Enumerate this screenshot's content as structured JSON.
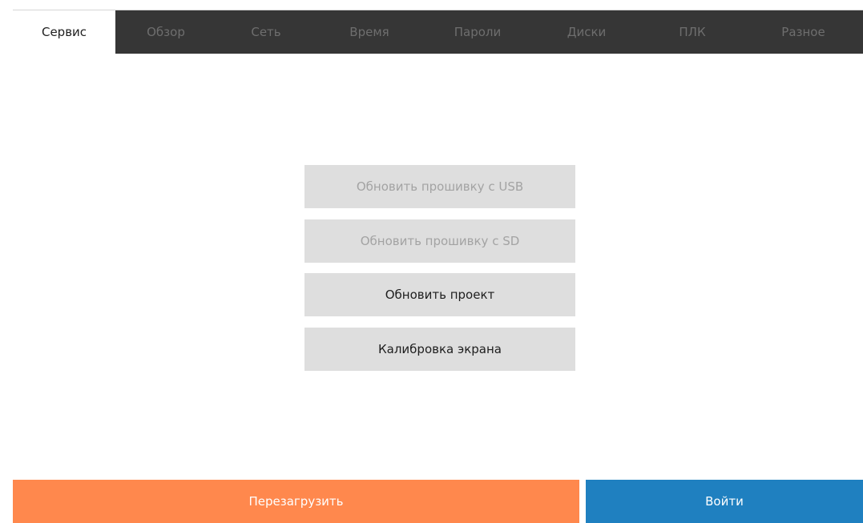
{
  "tabs": [
    {
      "label": "Сервис",
      "active": true
    },
    {
      "label": "Обзор",
      "active": false
    },
    {
      "label": "Сеть",
      "active": false
    },
    {
      "label": "Время",
      "active": false
    },
    {
      "label": "Пароли",
      "active": false
    },
    {
      "label": "Диски",
      "active": false
    },
    {
      "label": "ПЛК",
      "active": false
    },
    {
      "label": "Разное",
      "active": false
    }
  ],
  "service": {
    "buttons": [
      {
        "label": "Обновить прошивку с USB",
        "enabled": false
      },
      {
        "label": "Обновить прошивку с SD",
        "enabled": false
      },
      {
        "label": "Обновить проект",
        "enabled": true
      },
      {
        "label": "Калибровка экрана",
        "enabled": true
      }
    ]
  },
  "footer": {
    "reboot_label": "Перезагрузить",
    "login_label": "Войти"
  },
  "colors": {
    "tabbar_bg": "#363636",
    "button_bg": "#dedede",
    "reboot_bg": "#ff884d",
    "login_bg": "#1f80c0"
  }
}
